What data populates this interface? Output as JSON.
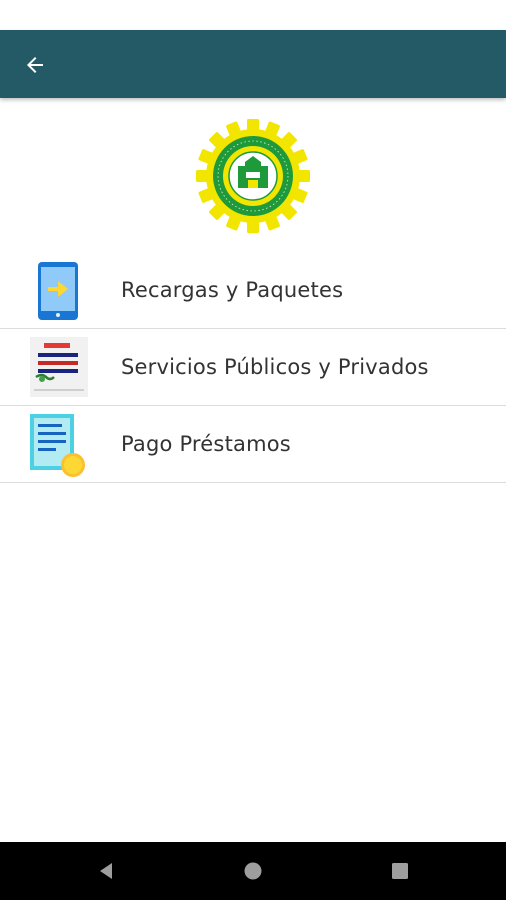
{
  "app_bar": {
    "background_color": "#245a66",
    "back_icon": "arrow-left-icon"
  },
  "logo": {
    "name": "cooperative-gear-logo",
    "colors": {
      "gear": "#f2e600",
      "ring": "#1f9a3a"
    }
  },
  "menu": {
    "items": [
      {
        "label": "Recargas y Paquetes",
        "icon": "phone-recharge-icon"
      },
      {
        "label": "Servicios Públicos y Privados",
        "icon": "services-bill-icon"
      },
      {
        "label": "Pago Préstamos",
        "icon": "loan-payment-icon"
      }
    ]
  },
  "nav_bar": {
    "buttons": [
      "back-triangle-icon",
      "home-circle-icon",
      "recents-square-icon"
    ]
  }
}
